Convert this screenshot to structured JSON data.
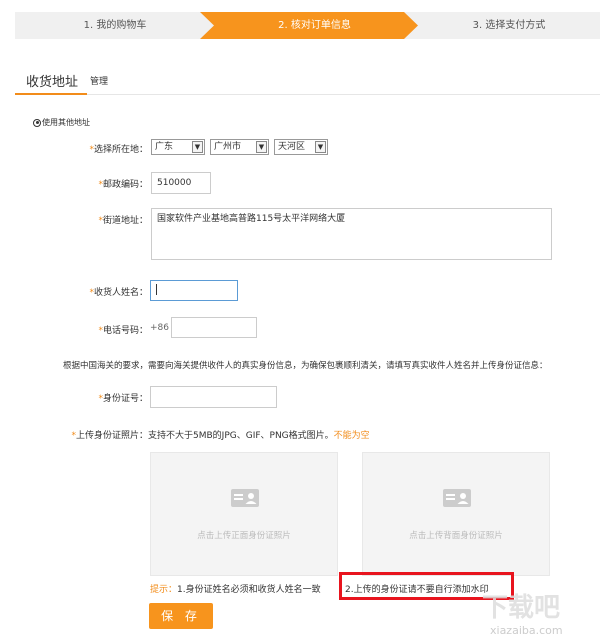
{
  "steps": [
    {
      "label": "1. 我的购物车"
    },
    {
      "label": "2. 核对订单信息"
    },
    {
      "label": "3. 选择支付方式"
    }
  ],
  "colors": {
    "accent": "#f28c1a",
    "active_step": "#f7941d",
    "highlight": "#e8141e"
  },
  "address_section": {
    "title": "收货地址",
    "manage_link": "管理",
    "use_other_address": "使用其他地址"
  },
  "form": {
    "region_label": "选择所在地：",
    "province": "广东",
    "city": "广州市",
    "district": "天河区",
    "zip_label": "邮政编码：",
    "zip_value": "510000",
    "street_label": "街道地址：",
    "street_value": "国家软件产业基地高普路115号太平洋网络大厦",
    "name_label": "收货人姓名：",
    "name_value": "",
    "phone_label": "电话号码：",
    "phone_prefix": "+86",
    "phone_value": "",
    "customs_note": "根据中国海关的要求，需要向海关提供收件人的真实身份信息，为确保包裹顺利清关，请填写真实收件人姓名并上传身份证信息：",
    "id_label": "身份证号：",
    "id_value": "",
    "id_photo_label": "上传身份证照片：",
    "id_photo_hint": "支持不大于5MB的JPG、GIF、PNG格式图片。",
    "id_photo_warn": "不能为空",
    "upload_front": "点击上传正面身份证照片",
    "upload_back": "点击上传背面身份证照片",
    "tip_label": "提示：",
    "tip_1": "1.身份证姓名必须和收货人姓名一致",
    "tip_2": "2.上传的身份证请不要自行添加水印",
    "save_label": "保 存"
  },
  "watermark": {
    "text": "xiazaiba.com"
  }
}
